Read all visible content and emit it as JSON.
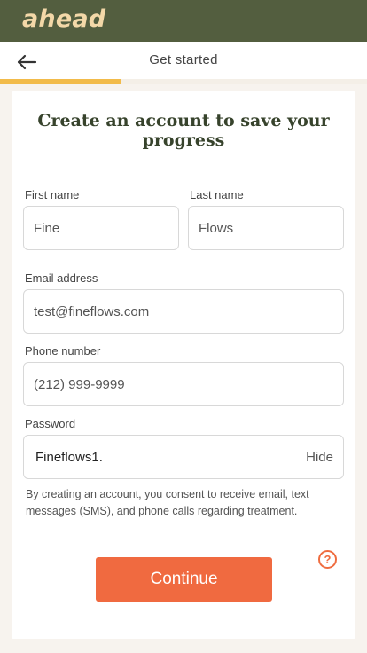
{
  "brand": {
    "logo_text": "ahead"
  },
  "nav": {
    "title": "Get started",
    "back_icon": "arrow-left-icon"
  },
  "progress": {
    "fraction": 0.33
  },
  "form": {
    "headline": "Create an account to save your progress",
    "first_name": {
      "label": "First name",
      "value": "Fine"
    },
    "last_name": {
      "label": "Last name",
      "value": "Flows"
    },
    "email": {
      "label": "Email address",
      "value": "test@fineflows.com"
    },
    "phone": {
      "label": "Phone number",
      "value": "(212) 999-9999"
    },
    "password": {
      "label": "Password",
      "value": "Fineflows1.",
      "toggle_label": "Hide"
    },
    "consent": "By creating an account, you consent to receive email, text messages (SMS), and phone calls regarding treatment.",
    "continue_label": "Continue",
    "help_icon": "?"
  },
  "colors": {
    "topbar": "#535e3f",
    "logo": "#f3d8a8",
    "progress": "#f2bb4a",
    "accent": "#f06a40",
    "headline": "#37432c"
  }
}
